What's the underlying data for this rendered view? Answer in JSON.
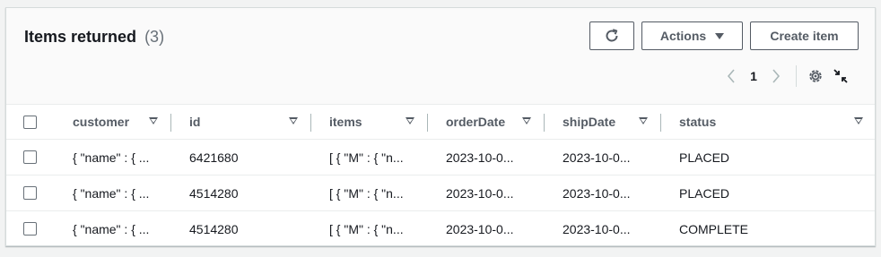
{
  "header": {
    "title": "Items returned",
    "count": "(3)",
    "actions_label": "Actions",
    "create_label": "Create item"
  },
  "pagination": {
    "current_page": "1"
  },
  "icons": {
    "refresh": "refresh-icon",
    "actions_caret": "caret-down-icon",
    "prev": "chevron-left-icon",
    "next": "chevron-right-icon",
    "settings": "gear-icon",
    "collapse": "collapse-icon"
  },
  "colors": {
    "border": "#d5dbdb",
    "text": "#16191f",
    "secondary": "#545b64"
  },
  "table": {
    "columns": [
      {
        "label": "customer"
      },
      {
        "label": "id"
      },
      {
        "label": "items"
      },
      {
        "label": "orderDate"
      },
      {
        "label": "shipDate"
      },
      {
        "label": "status"
      }
    ],
    "rows": [
      {
        "customer": "{ \"name\" : { ...",
        "id": "6421680",
        "items": "[ { \"M\" : { \"n...",
        "orderDate": "2023-10-0...",
        "shipDate": "2023-10-0...",
        "status": "PLACED"
      },
      {
        "customer": "{ \"name\" : { ...",
        "id": "4514280",
        "items": "[ { \"M\" : { \"n...",
        "orderDate": "2023-10-0...",
        "shipDate": "2023-10-0...",
        "status": "PLACED"
      },
      {
        "customer": "{ \"name\" : { ...",
        "id": "4514280",
        "items": "[ { \"M\" : { \"n...",
        "orderDate": "2023-10-0...",
        "shipDate": "2023-10-0...",
        "status": "COMPLETE"
      }
    ]
  }
}
